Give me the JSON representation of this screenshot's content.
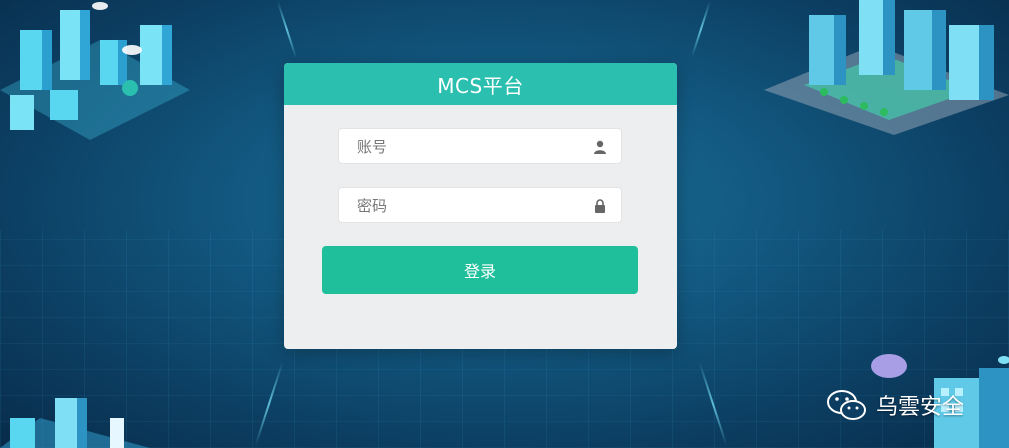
{
  "login": {
    "title": "MCS平台",
    "username_placeholder": "账号",
    "password_placeholder": "密码",
    "submit_label": "登录"
  },
  "watermark": {
    "text": "乌雲安全"
  },
  "icons": {
    "username": "user-icon",
    "password": "lock-icon"
  },
  "colors": {
    "header": "#2bbfb0",
    "button": "#1fbf9b",
    "panel": "#eceef0"
  }
}
